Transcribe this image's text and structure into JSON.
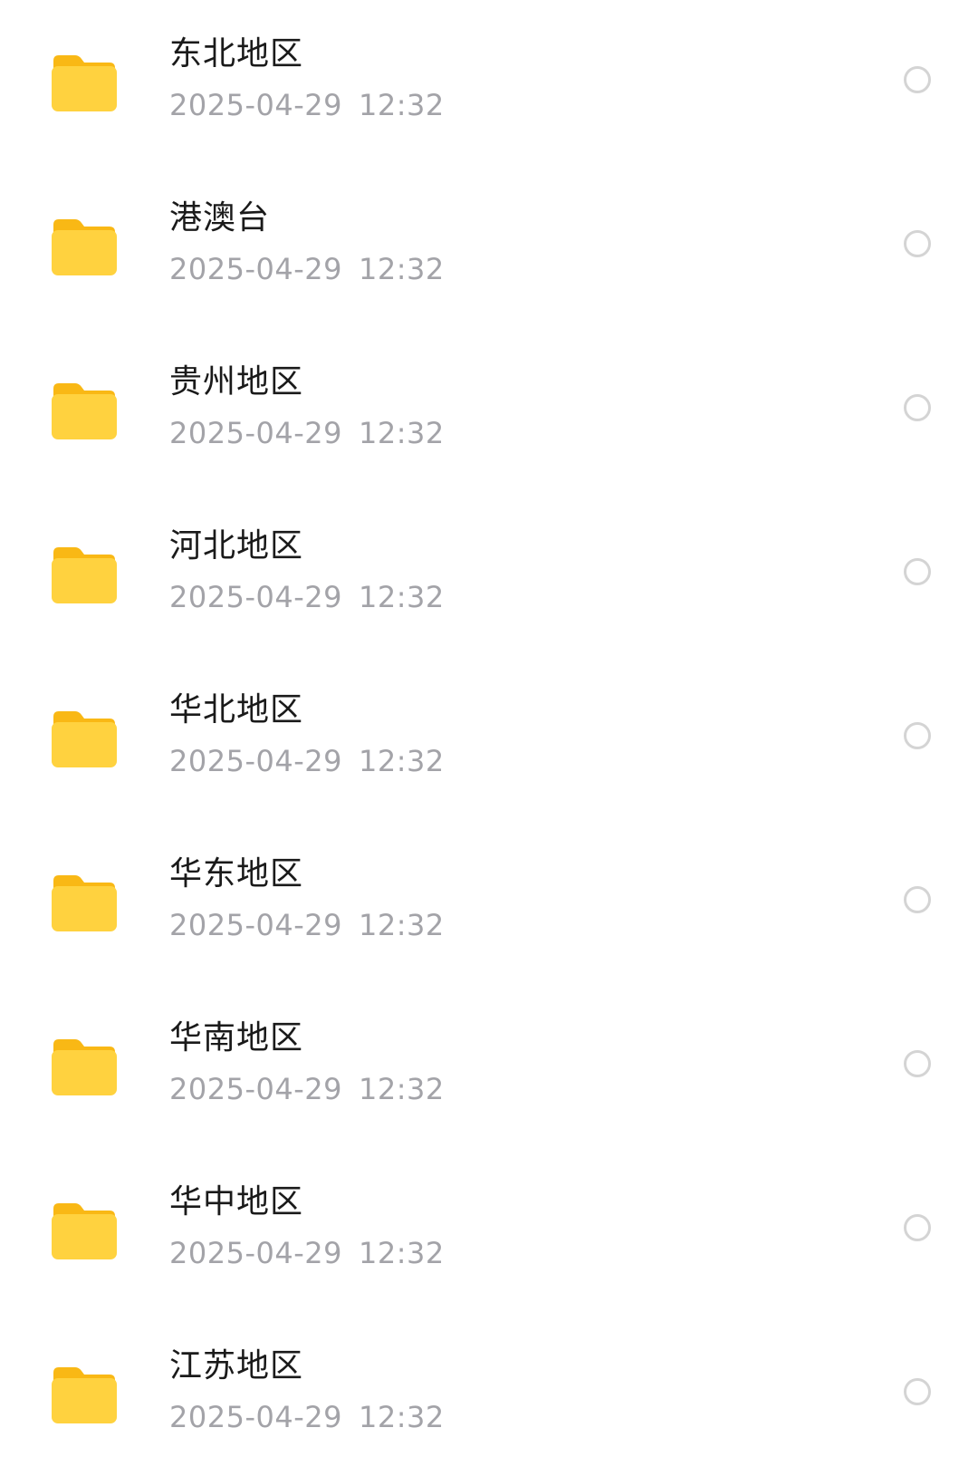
{
  "items": [
    {
      "name": "东北地区",
      "date": "2025-04-29",
      "time": "12:32"
    },
    {
      "name": "港澳台",
      "date": "2025-04-29",
      "time": "12:32"
    },
    {
      "name": "贵州地区",
      "date": "2025-04-29",
      "time": "12:32"
    },
    {
      "name": "河北地区",
      "date": "2025-04-29",
      "time": "12:32"
    },
    {
      "name": "华北地区",
      "date": "2025-04-29",
      "time": "12:32"
    },
    {
      "name": "华东地区",
      "date": "2025-04-29",
      "time": "12:32"
    },
    {
      "name": "华南地区",
      "date": "2025-04-29",
      "time": "12:32"
    },
    {
      "name": "华中地区",
      "date": "2025-04-29",
      "time": "12:32"
    },
    {
      "name": "江苏地区",
      "date": "2025-04-29",
      "time": "12:32"
    }
  ],
  "icons": {
    "item_icon": "folder-icon",
    "select_icon": "radio-unchecked-icon"
  },
  "colors": {
    "folder_front": "#FFD23F",
    "folder_back": "#F9B815",
    "name_text": "#1a1a1a",
    "time_text": "#a3a3a8",
    "radio_border": "#d4d4d4"
  }
}
